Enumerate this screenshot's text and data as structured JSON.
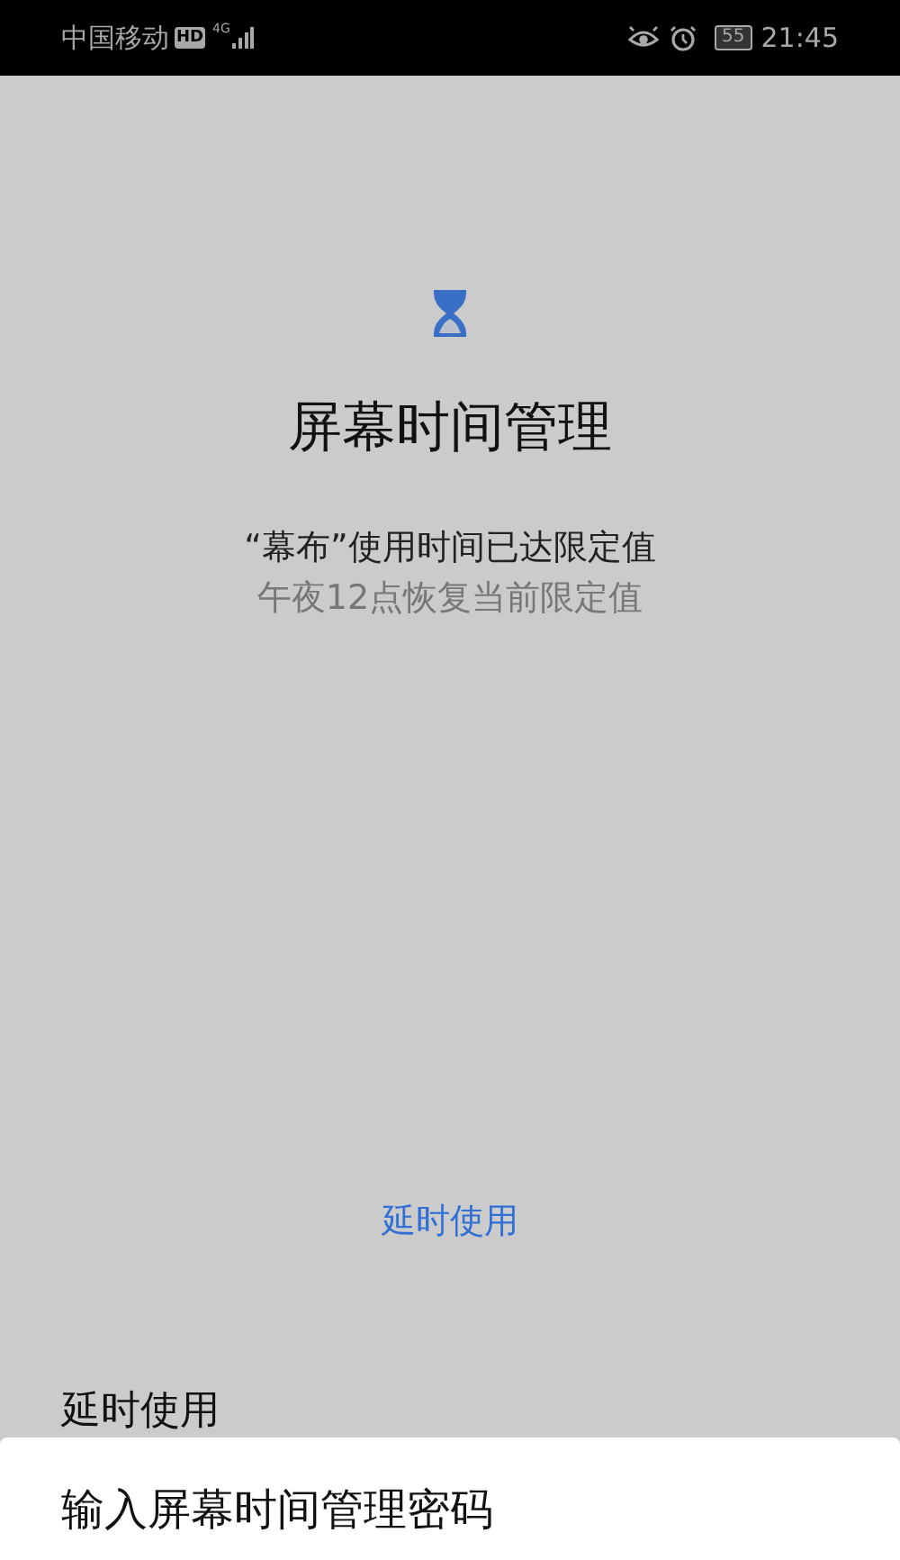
{
  "status_bar": {
    "carrier": "中国移动",
    "hd_badge": "HD",
    "network": "4G",
    "battery": "55",
    "time": "21:45"
  },
  "screen": {
    "title": "屏幕时间管理",
    "message": "“幕布”使用时间已达限定值",
    "note": "午夜12点恢复当前限定值",
    "delay_link": "延时使用"
  },
  "sheet": {
    "peek_title": "延时使用",
    "title": "输入屏幕时间管理密码"
  }
}
